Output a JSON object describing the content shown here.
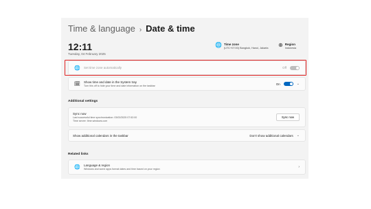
{
  "breadcrumb": {
    "parent": "Time & language",
    "separator": "›",
    "current": "Date & time"
  },
  "clock": {
    "time": "12:11",
    "date": "Tuesday, 04 February 2025"
  },
  "timezone_info": {
    "title": "Time zone",
    "value": "(UTC+07:00) Bangkok, Hanoi, Jakarta"
  },
  "region_info": {
    "title": "Region",
    "value": "Indonesia"
  },
  "auto_timezone": {
    "label": "Set time zone automatically",
    "state": "Off"
  },
  "systray": {
    "title": "Show time and date in the System tray",
    "subtitle": "Turn this off to hide your time and date information on the taskbar",
    "state": "On"
  },
  "additional": {
    "heading": "Additional settings",
    "sync": {
      "title": "Sync now",
      "line1": "Last successful time synchronization: 03/02/2025 07:52:00",
      "line2": "Time server: time.windows.com",
      "button": "Sync now"
    },
    "calendars": {
      "label": "Show additional calendars in the taskbar",
      "value": "Don't show additional calendars"
    }
  },
  "related": {
    "heading": "Related links",
    "language_region": {
      "title": "Language & region",
      "subtitle": "Windows and some apps format dates and time based on your region"
    }
  }
}
